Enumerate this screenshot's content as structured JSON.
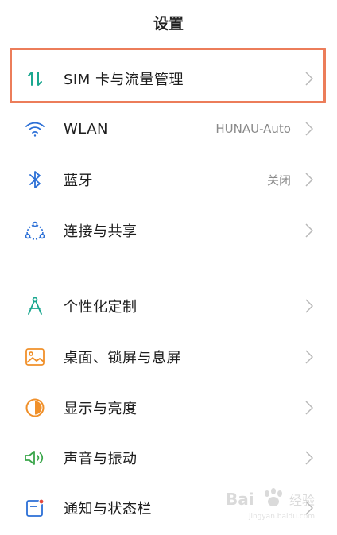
{
  "header": {
    "title": "设置"
  },
  "items": [
    {
      "label": "SIM 卡与流量管理",
      "value": "",
      "icon": "sim-data-icon",
      "color": "#1aa78f"
    },
    {
      "label": "WLAN",
      "value": "HUNAU-Auto",
      "icon": "wifi-icon",
      "color": "#2b6fd6"
    },
    {
      "label": "蓝牙",
      "value": "关闭",
      "icon": "bluetooth-icon",
      "color": "#2b6fd6"
    },
    {
      "label": "连接与共享",
      "value": "",
      "icon": "connection-share-icon",
      "color": "#2b6fd6"
    },
    {
      "label": "个性化定制",
      "value": "",
      "icon": "personalize-icon",
      "color": "#1aa78f"
    },
    {
      "label": "桌面、锁屏与息屏",
      "value": "",
      "icon": "wallpaper-icon",
      "color": "#f0902a"
    },
    {
      "label": "显示与亮度",
      "value": "",
      "icon": "display-brightness-icon",
      "color": "#f0902a"
    },
    {
      "label": "声音与振动",
      "value": "",
      "icon": "sound-icon",
      "color": "#3aa64a"
    },
    {
      "label": "通知与状态栏",
      "value": "",
      "icon": "notification-icon",
      "color": "#2b6fd6"
    }
  ],
  "watermark": {
    "text": "Bai 经验",
    "url": "jingyan.baidu.com"
  }
}
